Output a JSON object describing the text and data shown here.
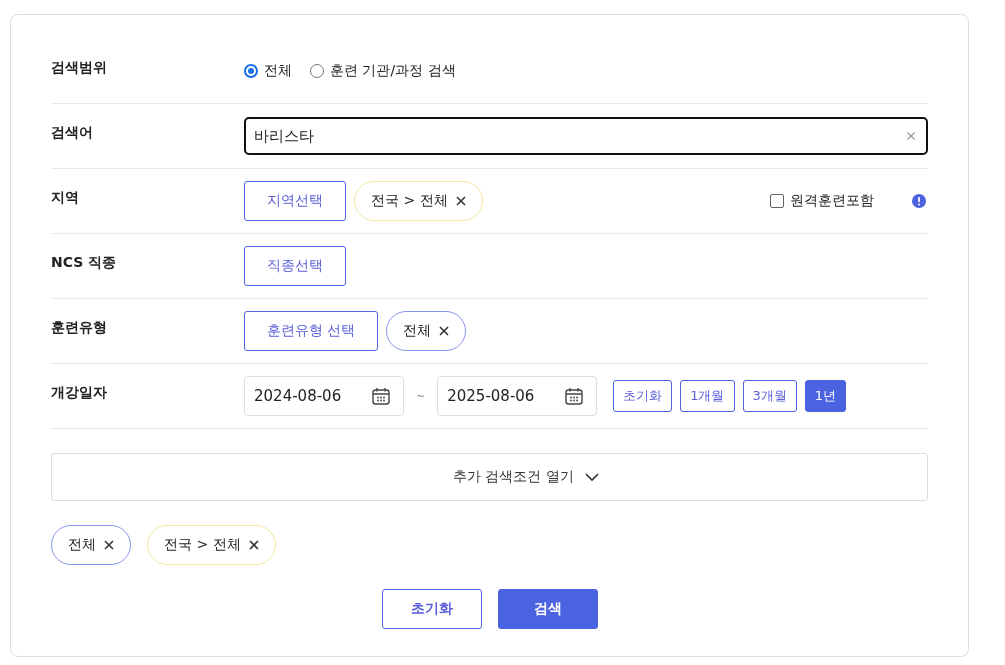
{
  "rows": [
    {
      "kind": "radio",
      "label": "검색범위",
      "options": [
        {
          "label": "전체",
          "selected": true
        },
        {
          "label": "훈련 기관/과정 검색",
          "selected": false
        }
      ]
    },
    {
      "kind": "text",
      "label": "검색어",
      "value": "바리스타"
    },
    {
      "kind": "picker",
      "label": "지역",
      "button": "지역선택",
      "chips": [
        {
          "label": "전국 > 전체",
          "color": "#f2e7a0"
        }
      ],
      "checkbox": {
        "label": "원격훈련포함",
        "checked": false
      }
    },
    {
      "kind": "picker",
      "label": "NCS 직종",
      "button": "직종선택",
      "chips": []
    },
    {
      "kind": "picker",
      "label": "훈련유형",
      "button": "훈련유형 선택",
      "chips": [
        {
          "label": "전체",
          "color": "#8a96ee"
        }
      ]
    },
    {
      "kind": "date",
      "label": "개강일자",
      "start": "2024-08-06",
      "separator": "~",
      "end": "2025-08-06",
      "periods": [
        {
          "label": "초기화",
          "selected": false
        },
        {
          "label": "1개월",
          "selected": false
        },
        {
          "label": "3개월",
          "selected": false
        },
        {
          "label": "1년",
          "selected": true
        }
      ]
    }
  ],
  "more": {
    "label": "추가 검색조건 열기",
    "expanded": false
  },
  "summary_chips": [
    {
      "label": "전체",
      "color": "#8a96ee"
    },
    {
      "label": "전국 > 전체",
      "color": "#f2e7a0"
    }
  ],
  "actions": [
    {
      "label": "초기화",
      "kind": "secondary"
    },
    {
      "label": "검색",
      "kind": "primary"
    }
  ]
}
